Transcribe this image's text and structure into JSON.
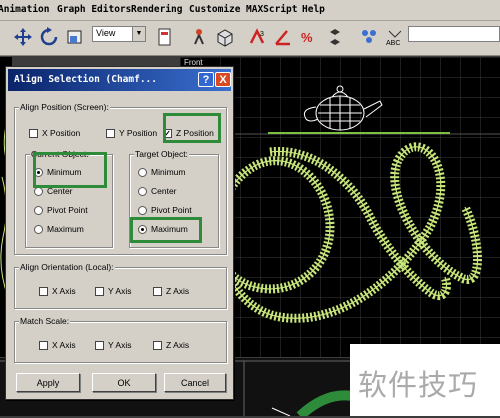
{
  "menu": [
    "Animation",
    "Graph Editors",
    "Rendering",
    "Customize",
    "MAXScript",
    "Help"
  ],
  "toolbar": {
    "view_select": "View",
    "icons": [
      "select-move-icon",
      "select-rotate-icon",
      "select-scale-icon",
      "view-dropdown",
      "selection-set-icon",
      "mirror-icon",
      "align-icon",
      "snap-3d-icon",
      "angle-snap-icon",
      "percent-snap-icon",
      "spinner-snap-icon",
      "layers-icon",
      "abc-icon"
    ]
  },
  "viewport": {
    "label": "Front"
  },
  "watermark": "软件技巧",
  "dialog": {
    "title": "Align Selection (Chamf...",
    "help_label": "?",
    "close_label": "X",
    "align_position": {
      "label": "Align Position (Screen):",
      "x": {
        "label": "X Position",
        "checked": false
      },
      "y": {
        "label": "Y Position",
        "checked": false
      },
      "z": {
        "label": "Z Position",
        "checked": true
      }
    },
    "current_object": {
      "label": "Current Object:",
      "options": [
        "Minimum",
        "Center",
        "Pivot Point",
        "Maximum"
      ],
      "selected": "Minimum"
    },
    "target_object": {
      "label": "Target Object:",
      "options": [
        "Minimum",
        "Center",
        "Pivot Point",
        "Maximum"
      ],
      "selected": "Maximum"
    },
    "align_orientation": {
      "label": "Align Orientation (Local):",
      "items": [
        "X Axis",
        "Y Axis",
        "Z Axis"
      ]
    },
    "match_scale": {
      "label": "Match Scale:",
      "items": [
        "X Axis",
        "Y Axis",
        "Z Axis"
      ]
    },
    "buttons": {
      "apply": "Apply",
      "ok": "OK",
      "cancel": "Cancel"
    }
  },
  "colors": {
    "highlight": "#2e8b3a",
    "wire": "#c8e67a",
    "titlebar": "#0a246a"
  }
}
